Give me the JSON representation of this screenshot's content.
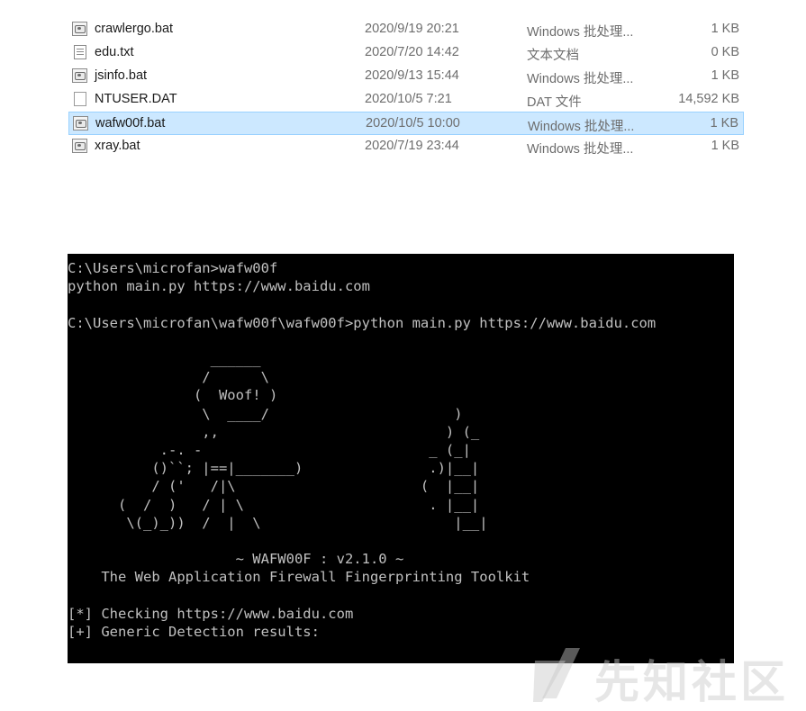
{
  "files": [
    {
      "name": "crawlergo.bat",
      "date": "2020/9/19 20:21",
      "type": "Windows 批处理...",
      "size": "1 KB",
      "icon": "batch-file-icon",
      "selected": false
    },
    {
      "name": "edu.txt",
      "date": "2020/7/20 14:42",
      "type": "文本文档",
      "size": "0 KB",
      "icon": "text-file-icon",
      "selected": false
    },
    {
      "name": "jsinfo.bat",
      "date": "2020/9/13 15:44",
      "type": "Windows 批处理...",
      "size": "1 KB",
      "icon": "batch-file-icon",
      "selected": false
    },
    {
      "name": "NTUSER.DAT",
      "date": "2020/10/5 7:21",
      "type": "DAT 文件",
      "size": "14,592 KB",
      "icon": "generic-file-icon",
      "selected": false
    },
    {
      "name": "wafw00f.bat",
      "date": "2020/10/5 10:00",
      "type": "Windows 批处理...",
      "size": "1 KB",
      "icon": "batch-file-icon",
      "selected": true
    },
    {
      "name": "xray.bat",
      "date": "2020/7/19 23:44",
      "type": "Windows 批处理...",
      "size": "1 KB",
      "icon": "batch-file-icon",
      "selected": false
    }
  ],
  "console": {
    "text": "C:\\Users\\microfan>wafw00f\npython main.py https://www.baidu.com\n\nC:\\Users\\microfan\\wafw00f\\wafw00f>python main.py https://www.baidu.com\n\n                 ______\n                /      \\\n               (  Woof! )\n                \\  ____/                      )\n                ,,                           ) (_\n           .-. -                           _ (_|\n          ()``; |==|_______)               .)|__|\n          / ('   /|\\                      (  |__|\n      (  /  )   / | \\                      . |__|\n       \\(_)_))  /  |  \\                       |__|\n\n                    ~ WAFW00F : v2.1.0 ~\n    The Web Application Firewall Fingerprinting Toolkit\n\n[*] Checking https://www.baidu.com\n[+] Generic Detection results:"
  },
  "watermark": {
    "text": "先知社区",
    "logo_icon": "xianzhi-logo-icon"
  },
  "colors": {
    "selection_bg": "#cce8ff",
    "selection_border": "#99d1ff",
    "console_bg": "#000000",
    "console_fg": "#c0c0c0"
  }
}
